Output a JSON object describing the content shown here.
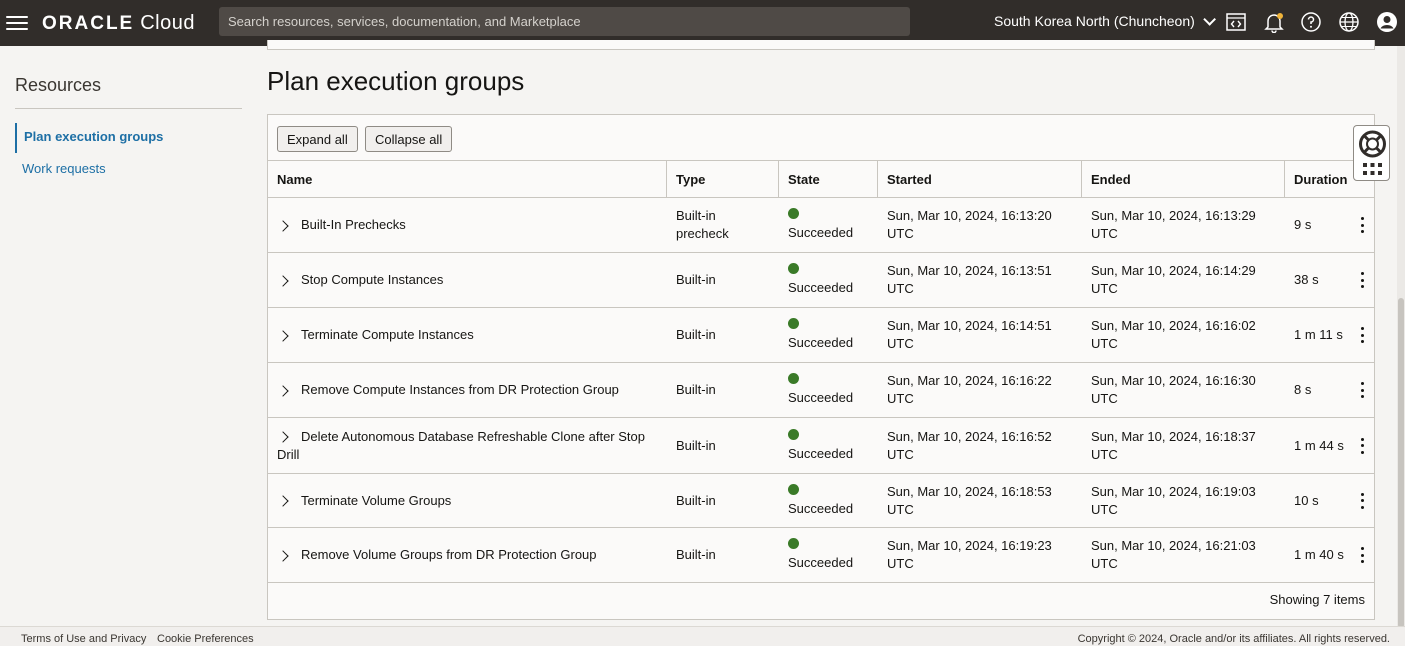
{
  "topbar": {
    "brand": "ORACLE",
    "product": "Cloud",
    "search_placeholder": "Search resources, services, documentation, and Marketplace",
    "region": "South Korea North (Chuncheon)"
  },
  "sidebar": {
    "title": "Resources",
    "items": [
      {
        "label": "Plan execution groups",
        "active": true
      },
      {
        "label": "Work requests",
        "active": false
      }
    ]
  },
  "main": {
    "title": "Plan execution groups",
    "expand_label": "Expand all",
    "collapse_label": "Collapse all",
    "columns": [
      "Name",
      "Type",
      "State",
      "Started",
      "Ended",
      "Duration"
    ],
    "rows": [
      {
        "name": "Built-In Prechecks",
        "type": "Built-in precheck",
        "state": "Succeeded",
        "started": "Sun, Mar 10, 2024, 16:13:20 UTC",
        "ended": "Sun, Mar 10, 2024, 16:13:29 UTC",
        "duration": "9 s"
      },
      {
        "name": "Stop Compute Instances",
        "type": "Built-in",
        "state": "Succeeded",
        "started": "Sun, Mar 10, 2024, 16:13:51 UTC",
        "ended": "Sun, Mar 10, 2024, 16:14:29 UTC",
        "duration": "38 s"
      },
      {
        "name": "Terminate Compute Instances",
        "type": "Built-in",
        "state": "Succeeded",
        "started": "Sun, Mar 10, 2024, 16:14:51 UTC",
        "ended": "Sun, Mar 10, 2024, 16:16:02 UTC",
        "duration": "1 m 11 s"
      },
      {
        "name": "Remove Compute Instances from DR Protection Group",
        "type": "Built-in",
        "state": "Succeeded",
        "started": "Sun, Mar 10, 2024, 16:16:22 UTC",
        "ended": "Sun, Mar 10, 2024, 16:16:30 UTC",
        "duration": "8 s"
      },
      {
        "name": "Delete Autonomous Database Refreshable Clone after Stop Drill",
        "type": "Built-in",
        "state": "Succeeded",
        "started": "Sun, Mar 10, 2024, 16:16:52 UTC",
        "ended": "Sun, Mar 10, 2024, 16:18:37 UTC",
        "duration": "1 m 44 s"
      },
      {
        "name": "Terminate Volume Groups",
        "type": "Built-in",
        "state": "Succeeded",
        "started": "Sun, Mar 10, 2024, 16:18:53 UTC",
        "ended": "Sun, Mar 10, 2024, 16:19:03 UTC",
        "duration": "10 s"
      },
      {
        "name": "Remove Volume Groups from DR Protection Group",
        "type": "Built-in",
        "state": "Succeeded",
        "started": "Sun, Mar 10, 2024, 16:19:23 UTC",
        "ended": "Sun, Mar 10, 2024, 16:21:03 UTC",
        "duration": "1 m 40 s"
      }
    ],
    "count_text": "Showing 7 items"
  },
  "footer": {
    "terms": "Terms of Use and Privacy",
    "cookies": "Cookie Preferences",
    "copyright": "Copyright © 2024, Oracle and/or its affiliates. All rights reserved."
  },
  "colors": {
    "topbar_bg": "#312d2a",
    "link": "#1d6fa5",
    "success": "#3a7a28"
  }
}
